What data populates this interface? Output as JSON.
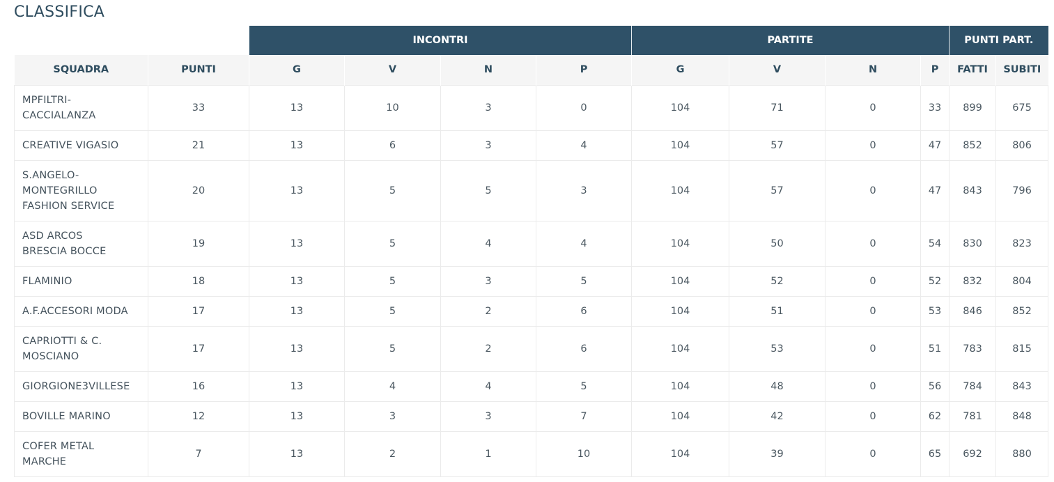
{
  "title": "CLASSIFICA",
  "groups": {
    "incontri": "INCONTRI",
    "partite": "PARTITE",
    "punti_part": "PUNTI PART."
  },
  "columns": [
    "SQUADRA",
    "PUNTI",
    "G",
    "V",
    "N",
    "P",
    "G",
    "V",
    "N",
    "P",
    "FATTI",
    "SUBITI"
  ],
  "rows": [
    {
      "team": "MPFILTRI-CACCIALANZA",
      "team_lines": [
        "MPFILTRI-",
        "CACCIALANZA"
      ],
      "punti": "33",
      "inc_g": "13",
      "inc_v": "10",
      "inc_n": "3",
      "inc_p": "0",
      "par_g": "104",
      "par_v": "71",
      "par_n": "0",
      "par_p": "33",
      "fatti": "899",
      "subiti": "675"
    },
    {
      "team": "CREATIVE VIGASIO",
      "team_lines": [
        "CREATIVE VIGASIO"
      ],
      "punti": "21",
      "inc_g": "13",
      "inc_v": "6",
      "inc_n": "3",
      "inc_p": "4",
      "par_g": "104",
      "par_v": "57",
      "par_n": "0",
      "par_p": "47",
      "fatti": "852",
      "subiti": "806"
    },
    {
      "team": "S.ANGELO-MONTEGRILLO FASHION SERVICE",
      "team_lines": [
        "S.ANGELO-",
        "MONTEGRILLO",
        "FASHION SERVICE"
      ],
      "punti": "20",
      "inc_g": "13",
      "inc_v": "5",
      "inc_n": "5",
      "inc_p": "3",
      "par_g": "104",
      "par_v": "57",
      "par_n": "0",
      "par_p": "47",
      "fatti": "843",
      "subiti": "796"
    },
    {
      "team": "ASD ARCOS BRESCIA BOCCE",
      "team_lines": [
        "ASD ARCOS",
        "BRESCIA BOCCE"
      ],
      "punti": "19",
      "inc_g": "13",
      "inc_v": "5",
      "inc_n": "4",
      "inc_p": "4",
      "par_g": "104",
      "par_v": "50",
      "par_n": "0",
      "par_p": "54",
      "fatti": "830",
      "subiti": "823"
    },
    {
      "team": "FLAMINIO",
      "team_lines": [
        "FLAMINIO"
      ],
      "punti": "18",
      "inc_g": "13",
      "inc_v": "5",
      "inc_n": "3",
      "inc_p": "5",
      "par_g": "104",
      "par_v": "52",
      "par_n": "0",
      "par_p": "52",
      "fatti": "832",
      "subiti": "804"
    },
    {
      "team": "A.F.ACCESORI MODA",
      "team_lines": [
        "A.F.ACCESORI MODA"
      ],
      "punti": "17",
      "inc_g": "13",
      "inc_v": "5",
      "inc_n": "2",
      "inc_p": "6",
      "par_g": "104",
      "par_v": "51",
      "par_n": "0",
      "par_p": "53",
      "fatti": "846",
      "subiti": "852"
    },
    {
      "team": "CAPRIOTTI & C. MOSCIANO",
      "team_lines": [
        "CAPRIOTTI & C.",
        "MOSCIANO"
      ],
      "punti": "17",
      "inc_g": "13",
      "inc_v": "5",
      "inc_n": "2",
      "inc_p": "6",
      "par_g": "104",
      "par_v": "53",
      "par_n": "0",
      "par_p": "51",
      "fatti": "783",
      "subiti": "815"
    },
    {
      "team": "GIORGIONE3VILLESE",
      "team_lines": [
        "GIORGIONE3VILLESE"
      ],
      "punti": "16",
      "inc_g": "13",
      "inc_v": "4",
      "inc_n": "4",
      "inc_p": "5",
      "par_g": "104",
      "par_v": "48",
      "par_n": "0",
      "par_p": "56",
      "fatti": "784",
      "subiti": "843"
    },
    {
      "team": "BOVILLE MARINO",
      "team_lines": [
        "BOVILLE MARINO"
      ],
      "punti": "12",
      "inc_g": "13",
      "inc_v": "3",
      "inc_n": "3",
      "inc_p": "7",
      "par_g": "104",
      "par_v": "42",
      "par_n": "0",
      "par_p": "62",
      "fatti": "781",
      "subiti": "848"
    },
    {
      "team": "COFER METAL MARCHE",
      "team_lines": [
        "COFER METAL",
        "MARCHE"
      ],
      "punti": "7",
      "inc_g": "13",
      "inc_v": "2",
      "inc_n": "1",
      "inc_p": "10",
      "par_g": "104",
      "par_v": "39",
      "par_n": "0",
      "par_p": "65",
      "fatti": "692",
      "subiti": "880"
    }
  ],
  "colors": {
    "header_bg": "#2f5168",
    "header_text": "#ffffff",
    "subheader_bg": "#f5f5f5",
    "title": "#2f4d5f"
  }
}
